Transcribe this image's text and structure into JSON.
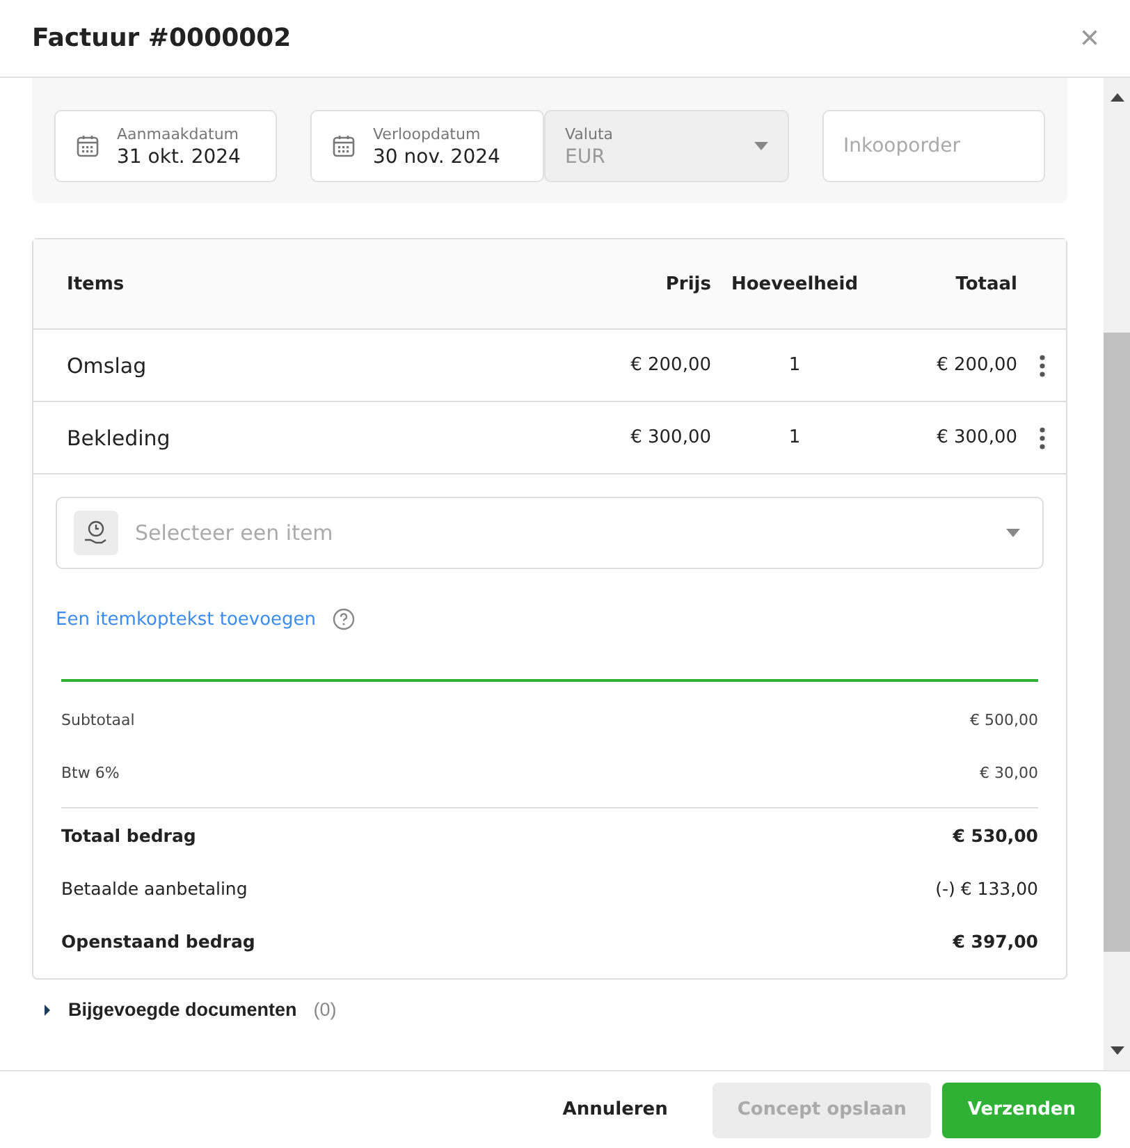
{
  "dialog": {
    "title": "Factuur #0000002",
    "close_label": "×"
  },
  "fields": [
    {
      "kind": "date",
      "label": "Aanmaakdatum",
      "value": "31 okt. 2024"
    },
    {
      "kind": "date",
      "label": "Verloopdatum",
      "value": "30 nov. 2024"
    },
    {
      "kind": "select",
      "label": "Valuta",
      "value": "EUR",
      "disabled": true
    },
    {
      "kind": "text",
      "placeholder": "Inkooporder"
    }
  ],
  "items_table": {
    "columns": [
      "Items",
      "Prijs",
      "Hoeveelheid",
      "Totaal"
    ],
    "rows": [
      {
        "item": "Omslag",
        "price": "€ 200,00",
        "quantity": "1",
        "total": "€ 200,00"
      },
      {
        "item": "Bekleding",
        "price": "€ 300,00",
        "quantity": "1",
        "total": "€ 300,00"
      }
    ]
  },
  "item_select": {
    "placeholder": "Selecteer een item"
  },
  "add_header_link": "Een itemkoptekst toevoegen",
  "summary": [
    {
      "kind": "normal",
      "label": "Subtotaal",
      "value": "€ 500,00"
    },
    {
      "kind": "normal",
      "label": "Btw 6%",
      "value": "€ 30,00"
    },
    {
      "kind": "divider"
    },
    {
      "kind": "bold",
      "label": "Totaal bedrag",
      "value": "€ 530,00"
    },
    {
      "kind": "strong",
      "label": "Betaalde aanbetaling",
      "value": "(-) € 133,00"
    },
    {
      "kind": "bold",
      "label": "Openstaand bedrag",
      "value": "€ 397,00"
    }
  ],
  "attachments": {
    "label": "Bijgevoegde documenten",
    "count": "(0)",
    "expanded": false
  },
  "buttons": [
    {
      "kind": "text",
      "label": "Annuleren",
      "disabled": false
    },
    {
      "kind": "secondary",
      "label": "Concept opslaan",
      "disabled": true
    },
    {
      "kind": "primary",
      "label": "Verzenden",
      "disabled": false
    }
  ]
}
